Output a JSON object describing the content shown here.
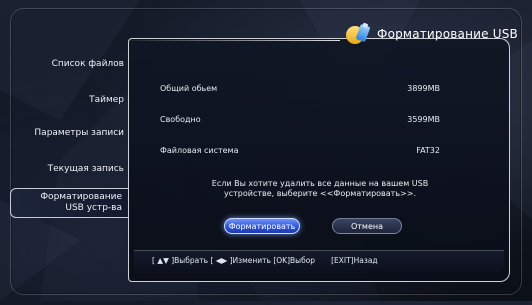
{
  "title": "Форматирование USB",
  "sidebar": {
    "items": [
      {
        "label": "Список файлов"
      },
      {
        "label": "Таймер"
      },
      {
        "label": "Параметры записи"
      },
      {
        "label": "Текущая запись"
      },
      {
        "label_line1": "Форматирование",
        "label_line2": "USB устр-ва",
        "active": true
      }
    ]
  },
  "info": {
    "total_label": "Общий обьем",
    "total_value": "3899MB",
    "free_label": "Свободно",
    "free_value": "3599MB",
    "fs_label": "Файловая система",
    "fs_value": "FAT32"
  },
  "message": {
    "line1": "Если Вы хотите удалить все данные на вашем USB",
    "line2": "устройстве, выберите <<Форматировать>>."
  },
  "buttons": {
    "format_label": "Форматировать",
    "cancel_label": "Отмена"
  },
  "hints": {
    "nav": "[ ▲▼ ]Выбрать [ ◀▶ ]Изменить [OK]Выбор",
    "exit": "[EXIT]Назад"
  },
  "colors": {
    "accent_blue": "#2f56d8",
    "panel_border": "#f0f4fa",
    "background": "#10151f"
  },
  "icon": "usb-format-icon"
}
